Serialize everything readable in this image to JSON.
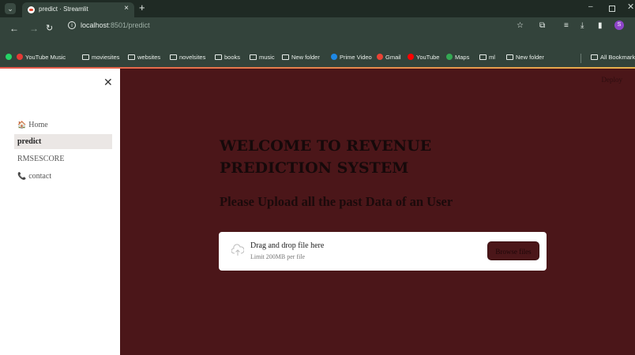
{
  "browser": {
    "tab_title": "predict · Streamlit",
    "url_host": "localhost",
    "url_port_path": ":8501/predict",
    "profile_initial": "S",
    "bookmarks": [
      {
        "label": "YouTube Music",
        "icon": "youtube-music-icon"
      },
      {
        "label": "moviesites",
        "icon": "folder-icon"
      },
      {
        "label": "websites",
        "icon": "folder-icon"
      },
      {
        "label": "novelsites",
        "icon": "folder-icon"
      },
      {
        "label": "books",
        "icon": "folder-icon"
      },
      {
        "label": "music",
        "icon": "folder-icon"
      },
      {
        "label": "New folder",
        "icon": "folder-icon"
      },
      {
        "label": "Prime Video",
        "icon": "prime-video-icon"
      },
      {
        "label": "Gmail",
        "icon": "gmail-icon"
      },
      {
        "label": "YouTube",
        "icon": "youtube-icon"
      },
      {
        "label": "Maps",
        "icon": "maps-icon"
      },
      {
        "label": "ml",
        "icon": "folder-icon"
      },
      {
        "label": "New folder",
        "icon": "folder-icon"
      }
    ],
    "all_bookmarks": "All Bookmarks"
  },
  "sidebar": {
    "items": [
      {
        "label": "Home",
        "icon": "house-icon"
      },
      {
        "label": "predict",
        "active": true
      },
      {
        "label": "RMSESCORE"
      },
      {
        "label": "contact",
        "icon": "phone-icon"
      }
    ]
  },
  "main": {
    "deploy_label": "Deploy",
    "heading": "WELCOME TO REVENUE PREDICTION SYSTEM",
    "subheading": "Please Upload all the past Data of an User",
    "uploader": {
      "title": "Drag and drop file here",
      "limit": "Limit 200MB per file",
      "button": "Browse files"
    }
  },
  "colors": {
    "accent": "#4b1619",
    "chrome": "#33433b"
  }
}
